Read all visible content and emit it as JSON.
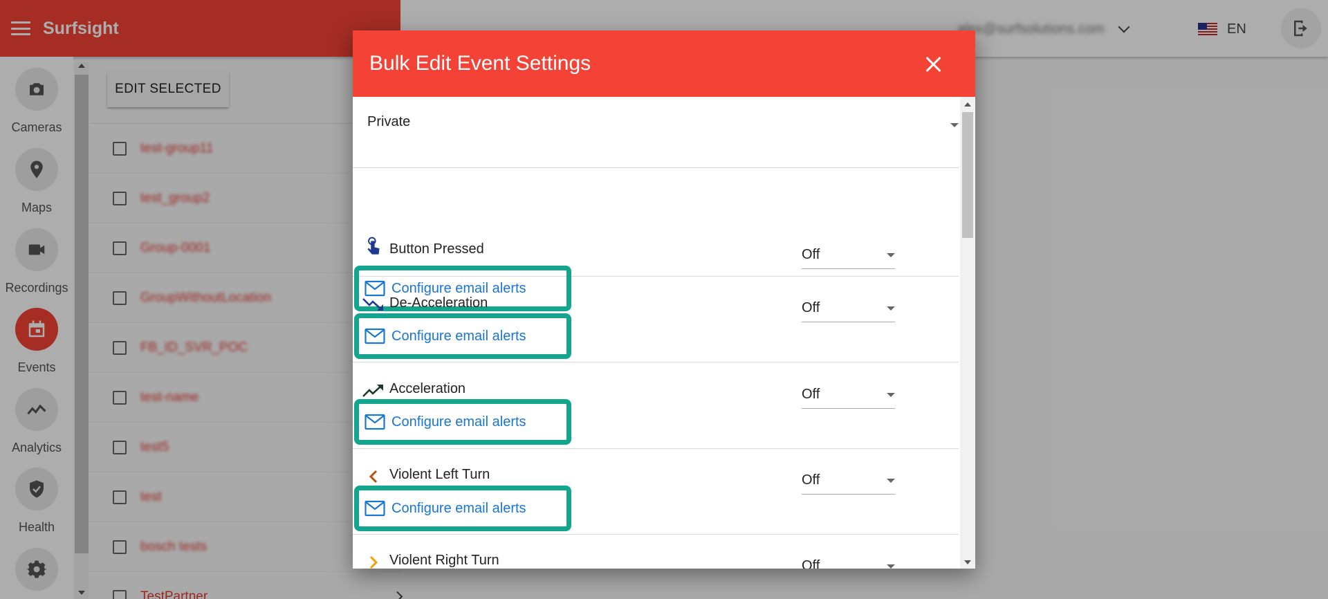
{
  "app": {
    "brand": "Surfsight"
  },
  "header": {
    "user_email": "alex@surfsolutions.com",
    "language": "EN"
  },
  "sidenav": {
    "items": [
      {
        "label": "Cameras",
        "icon": "camera-icon",
        "active": false
      },
      {
        "label": "Maps",
        "icon": "map-pin-icon",
        "active": false
      },
      {
        "label": "Recordings",
        "icon": "video-icon",
        "active": false
      },
      {
        "label": "Events",
        "icon": "calendar-icon",
        "active": true
      },
      {
        "label": "Analytics",
        "icon": "analytics-icon",
        "active": false
      },
      {
        "label": "Health",
        "icon": "shield-check-icon",
        "active": false
      },
      {
        "label": "",
        "icon": "gear-icon",
        "active": false
      }
    ]
  },
  "groups": {
    "edit_selected_label": "EDIT SELECTED",
    "rows": [
      "test-group11",
      "test_group2",
      "Group-0001",
      "GroupWithoutLocation",
      "FB_ID_SVR_POC",
      "test-name",
      "test5",
      "test",
      "bosch tests",
      "TestPartner"
    ]
  },
  "dialog": {
    "title": "Bulk Edit Event Settings",
    "privacy_value": "Private",
    "email_label": "Configure email alerts",
    "events": [
      {
        "name": "Button Pressed",
        "status": "Off",
        "icon": "hand-pointer-icon"
      },
      {
        "name": "De-Acceleration",
        "status": "Off",
        "icon": "trending-down-icon"
      },
      {
        "name": "Acceleration",
        "status": "Off",
        "icon": "trending-up-icon"
      },
      {
        "name": "Violent Left Turn",
        "status": "Off",
        "icon": "chevron-left-icon"
      },
      {
        "name": "Violent Right Turn",
        "status": "Off",
        "icon": "chevron-right-icon"
      }
    ]
  },
  "colors": {
    "brand_red": "#f44336",
    "highlight_teal": "#14a58f",
    "link_blue": "#1976d2"
  }
}
